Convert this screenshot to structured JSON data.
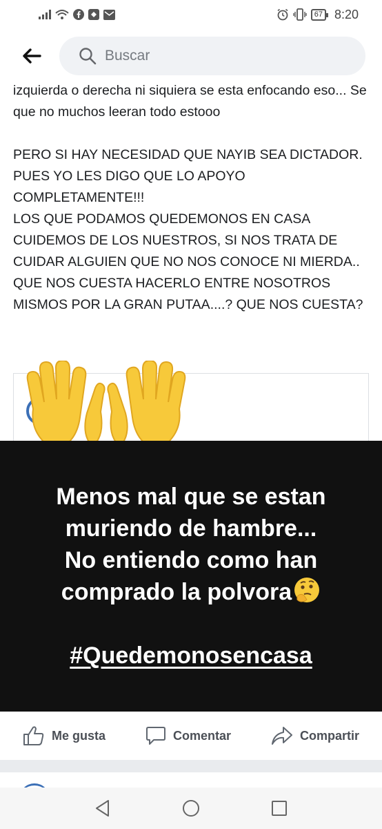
{
  "status_bar": {
    "battery": "67",
    "time": "8:20"
  },
  "header": {
    "search_placeholder": "Buscar"
  },
  "post": {
    "paragraphs": [
      "izquierda o derecha ni siquiera se esta enfocando eso... Se que no muchos leeran todo estooo",
      "PERO SI HAY NECESIDAD QUE NAYIB SEA DICTADOR. PUES YO LES DIGO QUE LO APOYO COMPLETAMENTE!!!",
      "LOS QUE PODAMOS QUEDEMONOS EN CASA CUIDEMOS DE LOS NUESTROS, SI NOS TRATA DE CUIDAR ALGUIEN QUE NO NOS CONOCE NI MIERDA.. QUE NOS CUESTA HACERLO ENTRE NOSOTROS MISMOS POR LA GRAN PUTAA....? QUE NOS CUESTA?"
    ]
  },
  "overlay": {
    "lines": [
      "Menos mal que se estan",
      "muriendo de hambre...",
      "No entiendo como han",
      "comprado la polvora"
    ],
    "hashtag": "#Quedemonosencasa"
  },
  "actions": {
    "like": "Me gusta",
    "comment": "Comentar",
    "share": "Compartir"
  },
  "colors": {
    "overlay_bg": "#111111",
    "search_bg": "#f0f2f5",
    "divider": "#e9ebee",
    "brand_blue": "#3b6fb6"
  },
  "icons": {
    "back": "arrow-left-icon",
    "search": "search-icon",
    "like": "thumbs-up-icon",
    "comment": "speech-bubble-icon",
    "share": "share-arrow-icon",
    "clapping": "raising-hands-emoji",
    "thinking": "thinking-face-emoji"
  }
}
